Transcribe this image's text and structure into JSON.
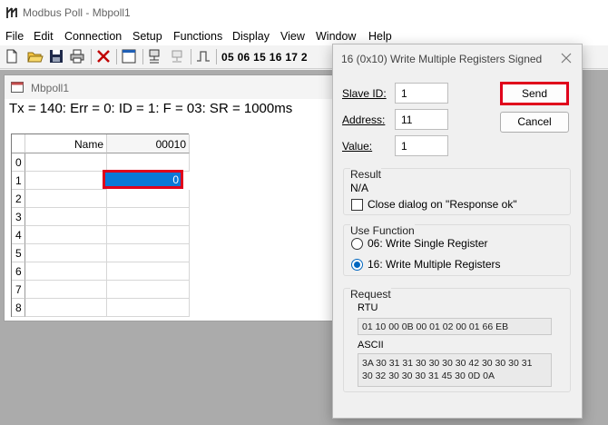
{
  "app": {
    "title": "Modbus Poll - Mbpoll1"
  },
  "menu": [
    "File",
    "Edit",
    "Connection",
    "Setup",
    "Functions",
    "Display",
    "View",
    "Window",
    "Help"
  ],
  "toolbar": {
    "function_codes": "05 06 15 16 17 2"
  },
  "child": {
    "title": "Mbpoll1",
    "status": "Tx = 140: Err = 0: ID = 1: F = 03: SR = 1000ms",
    "grid": {
      "name_header": "Name",
      "col_header": "00010",
      "rows": [
        "0",
        "1",
        "2",
        "3",
        "4",
        "5",
        "6",
        "7",
        "8"
      ],
      "selected_value": "0"
    }
  },
  "dialog": {
    "title": "16 (0x10) Write Multiple Registers Signed",
    "slave_id_label": "Slave ID:",
    "slave_id_value": "1",
    "address_label": "Address:",
    "address_value": "11",
    "value_label": "Value:",
    "value_value": "1",
    "send_label": "Send",
    "cancel_label": "Cancel",
    "result": {
      "title": "Result",
      "status": "N/A",
      "close_checkbox_label": "Close dialog on \"Response ok\"",
      "close_checkbox_checked": false
    },
    "use_function": {
      "title": "Use Function",
      "option_06": "06: Write Single Register",
      "option_16": "16: Write Multiple Registers",
      "selected": "16"
    },
    "request": {
      "title": "Request",
      "rtu_label": "RTU",
      "rtu_value": "01 10 00 0B 00 01 02 00 01 66 EB",
      "ascii_label": "ASCII",
      "ascii_line1": "3A 30 31 31 30 30 30 30 42 30 30 30 31",
      "ascii_line2": "30 32 30 30 30 31 45 30 0D 0A"
    }
  },
  "colors": {
    "selection": "#0a78d7",
    "highlight_border": "#e0001b"
  }
}
